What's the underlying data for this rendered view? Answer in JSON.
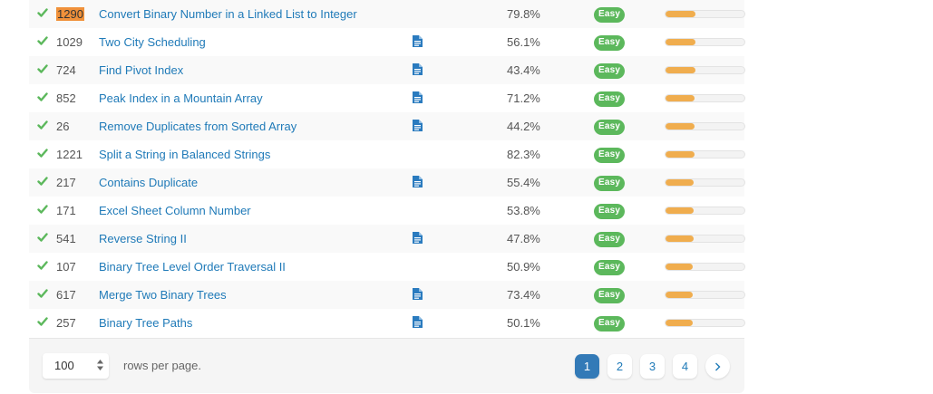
{
  "problems": [
    {
      "id": "1290",
      "title": "Convert Binary Number in a Linked List to Integer",
      "has_solution": false,
      "acceptance": "79.8%",
      "difficulty": "Easy",
      "frequency": 0.38,
      "highlighted": true
    },
    {
      "id": "1029",
      "title": "Two City Scheduling",
      "has_solution": true,
      "acceptance": "56.1%",
      "difficulty": "Easy",
      "frequency": 0.38
    },
    {
      "id": "724",
      "title": "Find Pivot Index",
      "has_solution": true,
      "acceptance": "43.4%",
      "difficulty": "Easy",
      "frequency": 0.38
    },
    {
      "id": "852",
      "title": "Peak Index in a Mountain Array",
      "has_solution": true,
      "acceptance": "71.2%",
      "difficulty": "Easy",
      "frequency": 0.37
    },
    {
      "id": "26",
      "title": "Remove Duplicates from Sorted Array",
      "has_solution": true,
      "acceptance": "44.2%",
      "difficulty": "Easy",
      "frequency": 0.37
    },
    {
      "id": "1221",
      "title": "Split a String in Balanced Strings",
      "has_solution": false,
      "acceptance": "82.3%",
      "difficulty": "Easy",
      "frequency": 0.37
    },
    {
      "id": "217",
      "title": "Contains Duplicate",
      "has_solution": true,
      "acceptance": "55.4%",
      "difficulty": "Easy",
      "frequency": 0.36
    },
    {
      "id": "171",
      "title": "Excel Sheet Column Number",
      "has_solution": false,
      "acceptance": "53.8%",
      "difficulty": "Easy",
      "frequency": 0.36
    },
    {
      "id": "541",
      "title": "Reverse String II",
      "has_solution": true,
      "acceptance": "47.8%",
      "difficulty": "Easy",
      "frequency": 0.36
    },
    {
      "id": "107",
      "title": "Binary Tree Level Order Traversal II",
      "has_solution": false,
      "acceptance": "50.9%",
      "difficulty": "Easy",
      "frequency": 0.35
    },
    {
      "id": "617",
      "title": "Merge Two Binary Trees",
      "has_solution": true,
      "acceptance": "73.4%",
      "difficulty": "Easy",
      "frequency": 0.35
    },
    {
      "id": "257",
      "title": "Binary Tree Paths",
      "has_solution": true,
      "acceptance": "50.1%",
      "difficulty": "Easy",
      "frequency": 0.35
    }
  ],
  "icons": {
    "status": "check-icon",
    "solution": "document-icon",
    "next": "chevron-right-icon",
    "select": "sort-arrows-icon"
  },
  "colors": {
    "check": "#5cb85c",
    "link": "#1f7ab8",
    "badge": "#5cb85c",
    "frequency": "#f0ad4e",
    "highlight": "#f0913a",
    "active_page": "#337ab7"
  },
  "footer": {
    "rows_per_page_value": "100",
    "rows_per_page_label": "rows per page.",
    "pages": [
      "1",
      "2",
      "3",
      "4"
    ],
    "current_page": "1"
  }
}
